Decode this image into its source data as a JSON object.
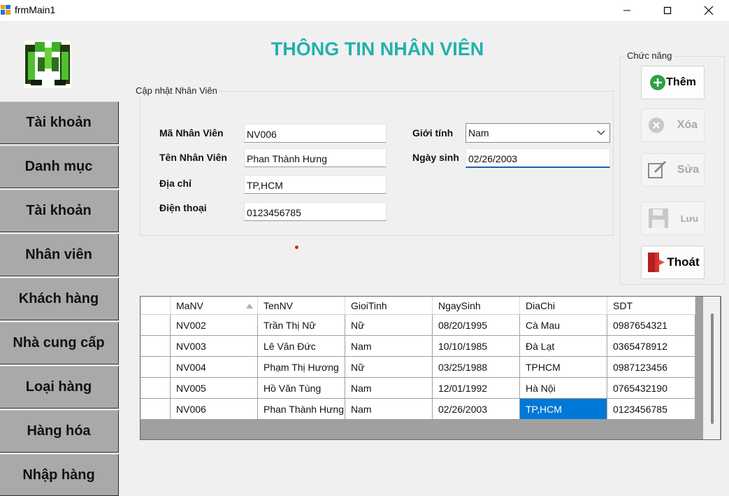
{
  "window": {
    "title": "frmMain1"
  },
  "form_title": "THÔNG TIN NHÂN VIÊN",
  "sidebar": {
    "items": [
      {
        "label": "Tài khoản"
      },
      {
        "label": "Danh mục"
      },
      {
        "label": "Tài khoản"
      },
      {
        "label": "Nhân viên"
      },
      {
        "label": "Khách hàng"
      },
      {
        "label": "Nhà cung cấp"
      },
      {
        "label": "Loại hàng"
      },
      {
        "label": "Hàng hóa"
      },
      {
        "label": "Nhập hàng"
      }
    ]
  },
  "update_group": {
    "legend": "Cập nhật Nhân Viên",
    "ma_nv": {
      "label": "Mã Nhân Viên",
      "value": "NV006"
    },
    "ten_nv": {
      "label": "Tên Nhân Viên",
      "value": "Phan Thành Hưng"
    },
    "dia_chi": {
      "label": "Địa chỉ",
      "value": "TP,HCM"
    },
    "dien_thoai": {
      "label": "Điện thoại",
      "value": "0123456785"
    },
    "gioi_tinh": {
      "label": "Giới tính",
      "value": "Nam"
    },
    "ngay_sinh": {
      "label": "Ngày sinh",
      "value": "02/26/2003"
    }
  },
  "actions": {
    "legend": "Chức năng",
    "them": "Thêm",
    "xoa": "Xóa",
    "sua": "Sửa",
    "luu": "Lưu",
    "thoat": "Thoát"
  },
  "grid": {
    "columns": [
      "MaNV",
      "TenNV",
      "GioiTinh",
      "NgaySinh",
      "DiaChi",
      "SDT"
    ],
    "rows": [
      [
        "NV002",
        "Trần Thị Nữ",
        "Nữ",
        "08/20/1995",
        "Cà Mau",
        "0987654321"
      ],
      [
        "NV003",
        "Lê Văn Đức",
        "Nam",
        "10/10/1985",
        "Đà Lạt",
        "0365478912"
      ],
      [
        "NV004",
        "Phạm Thị Hương",
        "Nữ",
        "03/25/1988",
        "TPHCM",
        "0987123456"
      ],
      [
        "NV005",
        "Hồ Văn Tùng",
        "Nam",
        "12/01/1992",
        "Hà Nội",
        "0765432190"
      ],
      [
        "NV006",
        "Phan Thành Hưng",
        "Nam",
        "02/26/2003",
        "TP,HCM",
        "0123456785"
      ]
    ],
    "selected_row": 4,
    "selected_col": 4
  },
  "colors": {
    "title": "#20b2aa",
    "selection": "#0078d7",
    "sidebar_button": "#a9a9a9"
  }
}
